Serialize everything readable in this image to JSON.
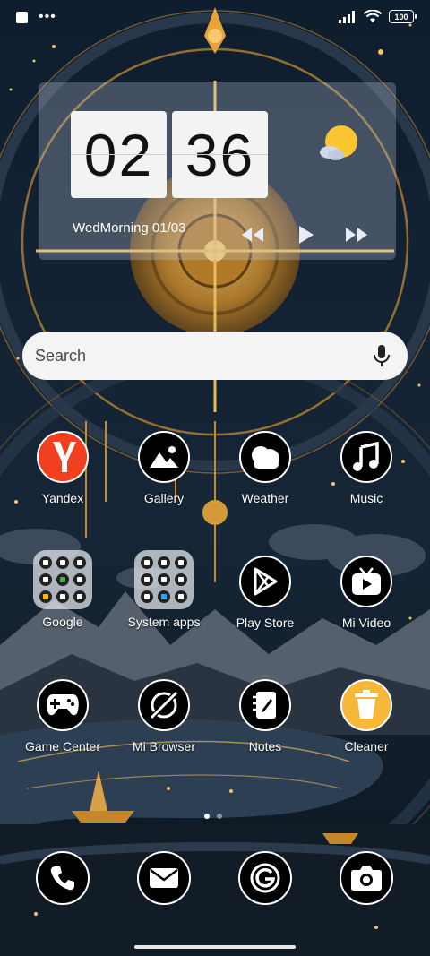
{
  "status_bar": {
    "battery": "100"
  },
  "clock_widget": {
    "hours": "02",
    "minutes": "36",
    "date": "WedMorning 01/03",
    "weather_icon": "sun-cloud-icon",
    "controls": [
      "rewind-icon",
      "play-icon",
      "fast-forward-icon"
    ]
  },
  "search": {
    "placeholder": "Search",
    "icon": "mic-icon"
  },
  "apps": [
    {
      "label": "Yandex",
      "icon": "yandex-icon"
    },
    {
      "label": "Gallery",
      "icon": "gallery-icon"
    },
    {
      "label": "Weather",
      "icon": "weather-icon"
    },
    {
      "label": "Music",
      "icon": "music-icon"
    },
    {
      "label": "Google",
      "icon": "folder-icon"
    },
    {
      "label": "System apps",
      "icon": "folder-icon"
    },
    {
      "label": "Play Store",
      "icon": "play-store-icon"
    },
    {
      "label": "Mi Video",
      "icon": "mi-video-icon"
    },
    {
      "label": "Game Center",
      "icon": "gamepad-icon"
    },
    {
      "label": "Mi Browser",
      "icon": "browser-icon"
    },
    {
      "label": "Notes",
      "icon": "notes-icon"
    },
    {
      "label": "Cleaner",
      "icon": "cleaner-icon"
    }
  ],
  "page_indicator": {
    "pages": 2,
    "current": 1
  },
  "dock": [
    "phone-icon",
    "messages-icon",
    "browser-g-icon",
    "camera-icon"
  ],
  "colors": {
    "accent_gold": "#e8a33a",
    "yandex_red": "#f0401f",
    "cleaner_yellow": "#f7b739"
  }
}
